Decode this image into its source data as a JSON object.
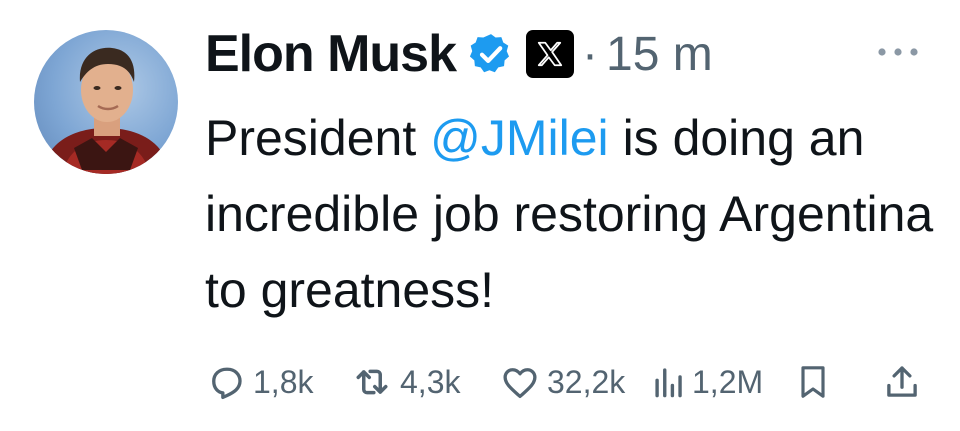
{
  "tweet": {
    "author": {
      "name": "Elon Musk",
      "verified_icon": "verified-badge-icon",
      "affiliation_icon": "x-logo-icon"
    },
    "separator": "·",
    "timestamp": "15 m",
    "more_icon": "more-options-icon",
    "text_before": "President ",
    "mention": "@JMilei",
    "text_after": " is doing an incredible job restoring Argentina to greatness!",
    "metrics": {
      "replies": "1,8k",
      "reposts": "4,3k",
      "likes": "32,2k",
      "views": "1,2M"
    },
    "action_icons": [
      "reply-icon",
      "repost-icon",
      "like-icon",
      "views-icon",
      "bookmark-icon",
      "share-icon"
    ],
    "colors": {
      "accent": "#1d9bf0",
      "text": "#0f1419",
      "muted": "#536471"
    }
  }
}
